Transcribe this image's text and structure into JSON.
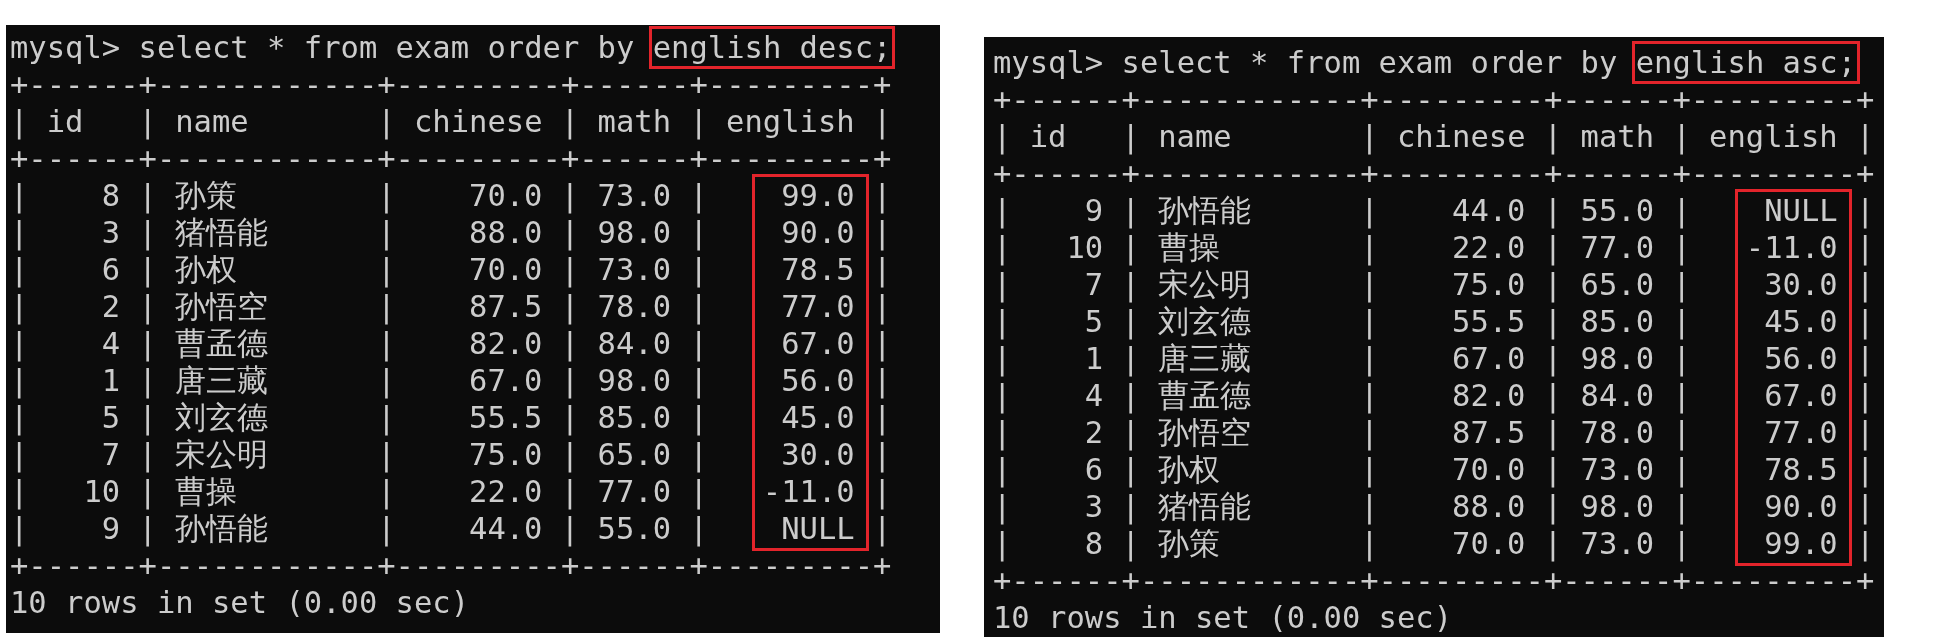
{
  "terminals": [
    {
      "prompt": "mysql>",
      "command": [
        {
          "text": "select * from exam order by",
          "highlighted": false
        },
        {
          "text": "english desc;",
          "highlighted": true
        }
      ],
      "table": {
        "border": "+------+------------+---------+------+---------+",
        "separator": "|",
        "columns": [
          {
            "label": "id",
            "kind": "number",
            "highlighted": false
          },
          {
            "label": "name",
            "kind": "text",
            "highlighted": false
          },
          {
            "label": "chinese",
            "kind": "number",
            "highlighted": false
          },
          {
            "label": "math",
            "kind": "number",
            "highlighted": false
          },
          {
            "label": "english",
            "kind": "number",
            "highlighted": true
          }
        ],
        "rows": [
          [
            "8",
            "孙策",
            "70.0",
            "73.0",
            "99.0"
          ],
          [
            "3",
            "猪悟能",
            "88.0",
            "98.0",
            "90.0"
          ],
          [
            "6",
            "孙权",
            "70.0",
            "73.0",
            "78.5"
          ],
          [
            "2",
            "孙悟空",
            "87.5",
            "78.0",
            "77.0"
          ],
          [
            "4",
            "曹孟德",
            "82.0",
            "84.0",
            "67.0"
          ],
          [
            "1",
            "唐三藏",
            "67.0",
            "98.0",
            "56.0"
          ],
          [
            "5",
            "刘玄德",
            "55.5",
            "85.0",
            "45.0"
          ],
          [
            "7",
            "宋公明",
            "75.0",
            "65.0",
            "30.0"
          ],
          [
            "10",
            "曹操",
            "22.0",
            "77.0",
            "-11.0"
          ],
          [
            "9",
            "孙悟能",
            "44.0",
            "55.0",
            "NULL"
          ]
        ]
      },
      "footer": "10 rows in set (0.00 sec)"
    },
    {
      "prompt": "mysql>",
      "command": [
        {
          "text": "select * from exam order by",
          "highlighted": false
        },
        {
          "text": "english asc;",
          "highlighted": true
        }
      ],
      "table": {
        "border": "+------+------------+---------+------+---------+",
        "separator": "|",
        "columns": [
          {
            "label": "id",
            "kind": "number",
            "highlighted": false
          },
          {
            "label": "name",
            "kind": "text",
            "highlighted": false
          },
          {
            "label": "chinese",
            "kind": "number",
            "highlighted": false
          },
          {
            "label": "math",
            "kind": "number",
            "highlighted": false
          },
          {
            "label": "english",
            "kind": "number",
            "highlighted": true
          }
        ],
        "rows": [
          [
            "9",
            "孙悟能",
            "44.0",
            "55.0",
            "NULL"
          ],
          [
            "10",
            "曹操",
            "22.0",
            "77.0",
            "-11.0"
          ],
          [
            "7",
            "宋公明",
            "75.0",
            "65.0",
            "30.0"
          ],
          [
            "5",
            "刘玄德",
            "55.5",
            "85.0",
            "45.0"
          ],
          [
            "1",
            "唐三藏",
            "67.0",
            "98.0",
            "56.0"
          ],
          [
            "4",
            "曹孟德",
            "82.0",
            "84.0",
            "67.0"
          ],
          [
            "2",
            "孙悟空",
            "87.5",
            "78.0",
            "77.0"
          ],
          [
            "6",
            "孙权",
            "70.0",
            "73.0",
            "78.5"
          ],
          [
            "3",
            "猪悟能",
            "88.0",
            "98.0",
            "90.0"
          ],
          [
            "8",
            "孙策",
            "70.0",
            "73.0",
            "99.0"
          ]
        ]
      },
      "footer": "10 rows in set (0.00 sec)"
    }
  ]
}
